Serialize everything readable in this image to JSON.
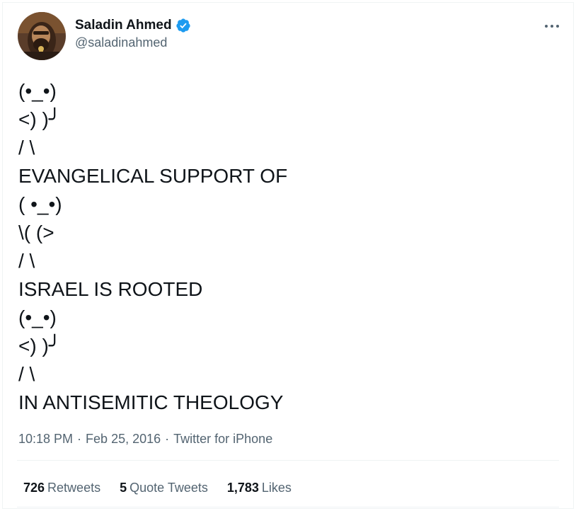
{
  "author": {
    "display_name": "Saladin Ahmed",
    "handle": "@saladinahmed",
    "verified_icon": "verified-badge-icon",
    "verified_color": "#1d9bf0",
    "avatar_icon": "profile-photo"
  },
  "menu": {
    "more_icon": "more-options-icon"
  },
  "tweet": {
    "lines": [
      "(•_•)",
      "<) )╯",
      "/ \\",
      "EVANGELICAL SUPPORT OF",
      "( •_•)",
      "\\( (>",
      "/ \\",
      "ISRAEL IS ROOTED",
      "(•_•)",
      "<) )╯",
      "/ \\",
      "IN ANTISEMITIC THEOLOGY"
    ]
  },
  "meta": {
    "time": "10:18 PM",
    "separator": "·",
    "date": "Feb 25, 2016",
    "source": "Twitter for iPhone"
  },
  "stats": {
    "retweets_count": "726",
    "retweets_label": "Retweets",
    "quotes_count": "5",
    "quotes_label": "Quote Tweets",
    "likes_count": "1,783",
    "likes_label": "Likes"
  },
  "colors": {
    "text": "#0f1419",
    "secondary": "#536471",
    "divider": "#eff3f4",
    "accent": "#1d9bf0"
  }
}
